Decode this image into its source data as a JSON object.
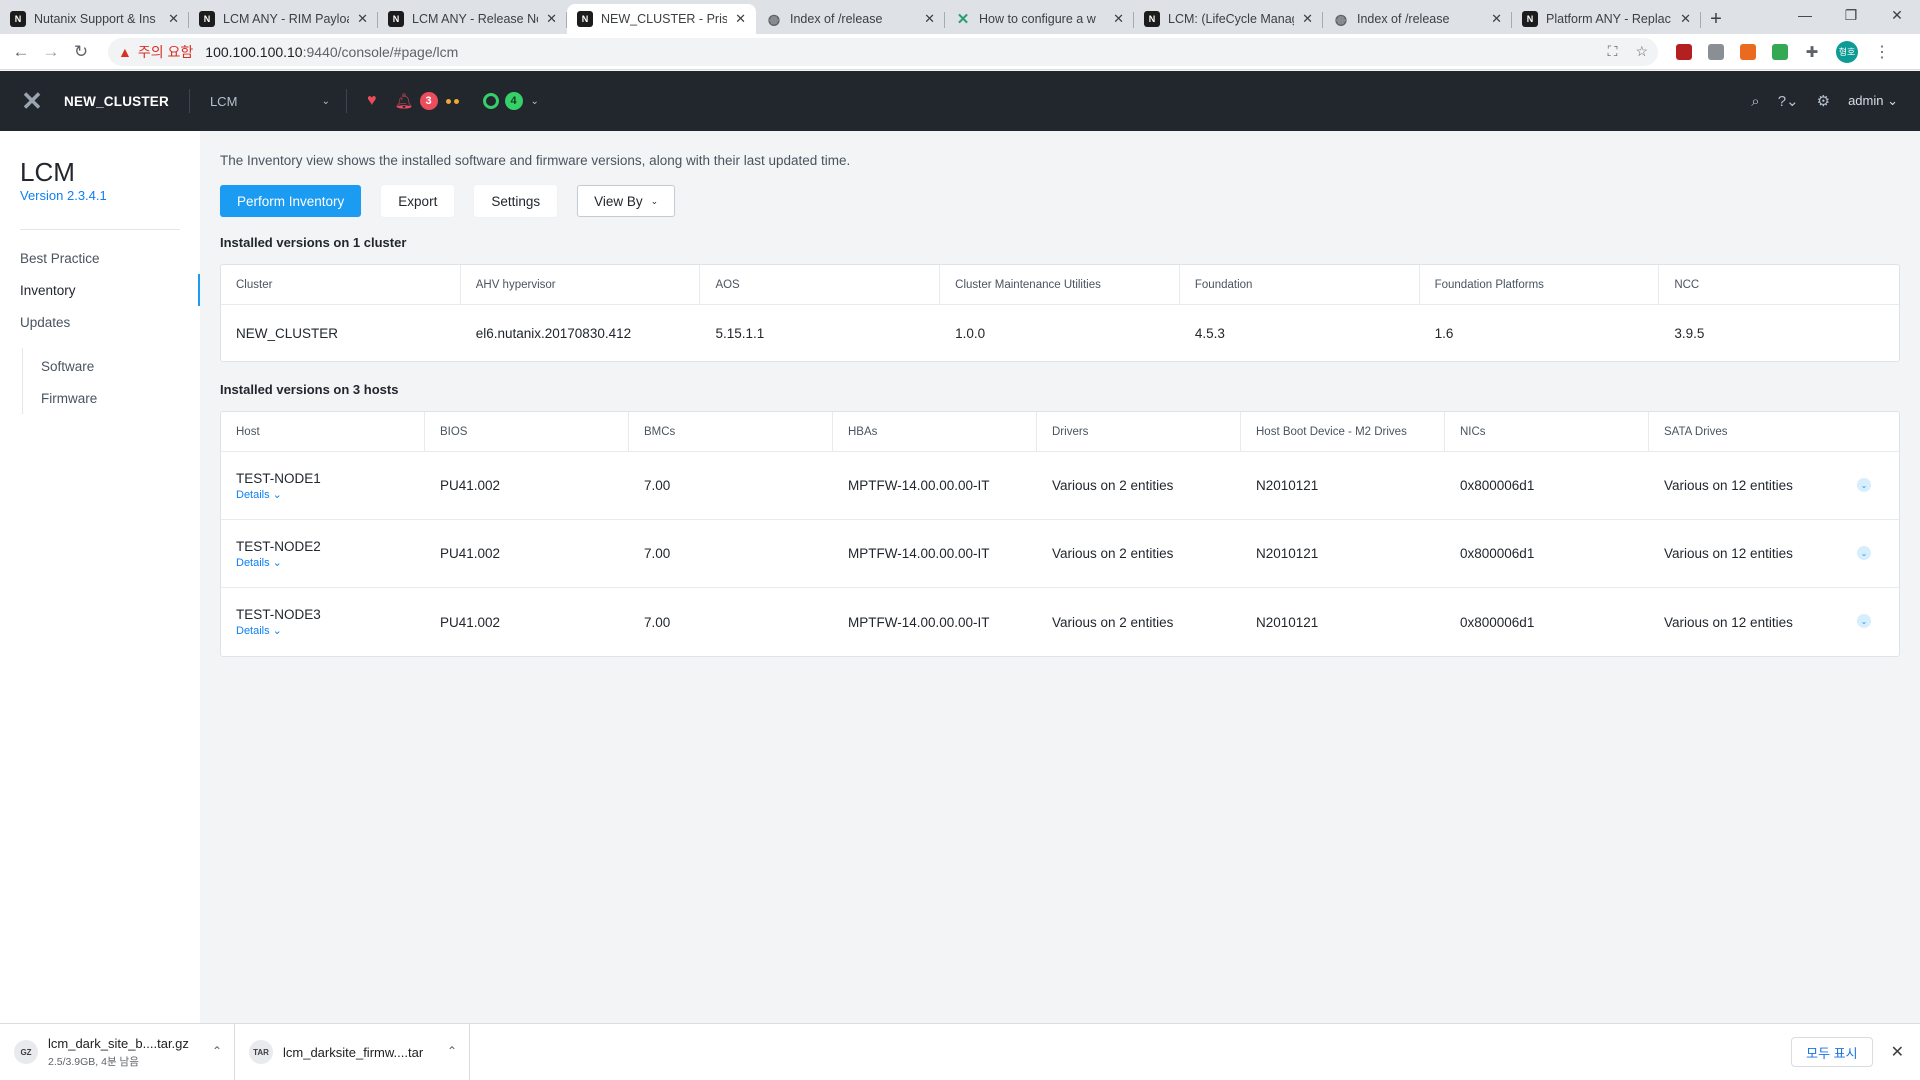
{
  "browser": {
    "tabs": [
      {
        "title": "Nutanix Support & Ins",
        "icon": "nutanix-favicon"
      },
      {
        "title": "LCM ANY - RIM Payloa",
        "icon": "nutanix-favicon"
      },
      {
        "title": "LCM ANY - Release No",
        "icon": "nutanix-favicon"
      },
      {
        "title": "NEW_CLUSTER - Prism",
        "icon": "nutanix-favicon",
        "active": true
      },
      {
        "title": "Index of /release",
        "icon": "globe-icon"
      },
      {
        "title": "How to configure a w",
        "icon": "nutanix-x-favicon"
      },
      {
        "title": "LCM: (LifeCycle Manag",
        "icon": "nutanix-favicon"
      },
      {
        "title": "Index of /release",
        "icon": "globe-icon"
      },
      {
        "title": "Platform ANY - Replac",
        "icon": "nutanix-favicon"
      }
    ],
    "security_warning": "주의 요함",
    "url_host": "100.100.100.10",
    "url_rest": ":9440/console/#page/lcm",
    "profile_initials": "형호"
  },
  "header": {
    "cluster_name": "NEW_CLUSTER",
    "page_select": "LCM",
    "alert_count": "3",
    "task_count": "4",
    "user": "admin"
  },
  "sidebar": {
    "title": "LCM",
    "version": "Version 2.3.4.1",
    "items": [
      {
        "label": "Best Practice"
      },
      {
        "label": "Inventory",
        "active": true
      },
      {
        "label": "Updates"
      }
    ],
    "sub_items": [
      {
        "label": "Software"
      },
      {
        "label": "Firmware"
      }
    ]
  },
  "main": {
    "intro": "The Inventory view shows the installed software and firmware versions, along with their last updated time.",
    "buttons": {
      "perform_inventory": "Perform Inventory",
      "export": "Export",
      "settings": "Settings",
      "view_by": "View By"
    },
    "cluster_section_title": "Installed versions on 1 cluster",
    "cluster_table": {
      "columns": [
        "Cluster",
        "AHV hypervisor",
        "AOS",
        "Cluster Maintenance Utilities",
        "Foundation",
        "Foundation Platforms",
        "NCC"
      ],
      "row": [
        "NEW_CLUSTER",
        "el6.nutanix.20170830.412",
        "5.15.1.1",
        "1.0.0",
        "4.5.3",
        "1.6",
        "3.9.5"
      ]
    },
    "host_section_title": "Installed versions on 3 hosts",
    "host_table": {
      "columns": [
        "Host",
        "BIOS",
        "BMCs",
        "HBAs",
        "Drivers",
        "Host Boot Device - M2 Drives",
        "NICs",
        "SATA Drives"
      ],
      "details_label": "Details",
      "rows": [
        {
          "host": "TEST-NODE1",
          "bios": "PU41.002",
          "bmcs": "7.00",
          "hbas": "MPTFW-14.00.00.00-IT",
          "drivers": "Various on 2 entities",
          "boot": "N2010121",
          "nics": "0x800006d1",
          "sata": "Various on 12 entities"
        },
        {
          "host": "TEST-NODE2",
          "bios": "PU41.002",
          "bmcs": "7.00",
          "hbas": "MPTFW-14.00.00.00-IT",
          "drivers": "Various on 2 entities",
          "boot": "N2010121",
          "nics": "0x800006d1",
          "sata": "Various on 12 entities"
        },
        {
          "host": "TEST-NODE3",
          "bios": "PU41.002",
          "bmcs": "7.00",
          "hbas": "MPTFW-14.00.00.00-IT",
          "drivers": "Various on 2 entities",
          "boot": "N2010121",
          "nics": "0x800006d1",
          "sata": "Various on 12 entities"
        }
      ]
    }
  },
  "downloads": {
    "items": [
      {
        "name": "lcm_dark_site_b....tar.gz",
        "status": "2.5/3.9GB, 4분 남음",
        "icon_label": "GZ"
      },
      {
        "name": "lcm_darksite_firmw....tar",
        "status": "",
        "icon_label": "TAR"
      }
    ],
    "show_all": "모두 표시"
  },
  "colors": {
    "accent": "#1b9bf1",
    "header_bg": "#22272e",
    "link": "#0d7ff5",
    "alert": "#ec4d5c",
    "ok": "#36d068"
  }
}
